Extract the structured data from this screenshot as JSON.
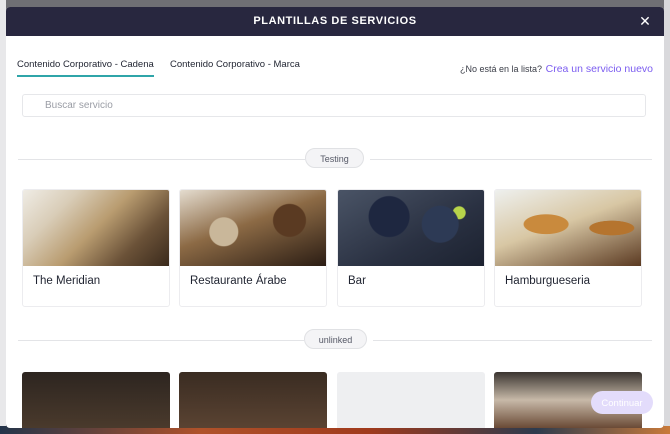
{
  "modal": {
    "title": "PLANTILLAS DE SERVICIOS",
    "close_icon": "close-icon"
  },
  "tabs": [
    {
      "label": "Contenido Corporativo - Cadena",
      "active": true
    },
    {
      "label": "Contenido Corporativo - Marca",
      "active": false
    }
  ],
  "not_listed_text": "¿No está en la lista?",
  "create_link": "Crea un servicio nuevo",
  "search": {
    "placeholder": "Buscar servicio"
  },
  "groups": [
    {
      "label": "Testing",
      "cards": [
        {
          "name": "The Meridian"
        },
        {
          "name": "Restaurante Árabe"
        },
        {
          "name": "Bar"
        },
        {
          "name": "Hamburgueseria"
        }
      ]
    },
    {
      "label": "unlinked"
    }
  ],
  "continue_label": "Continuar",
  "colors": {
    "header_bg": "#28273f",
    "tab_underline": "#2fa5a9",
    "link": "#7b5cf0",
    "continue_disabled": "#e3dcfb"
  }
}
